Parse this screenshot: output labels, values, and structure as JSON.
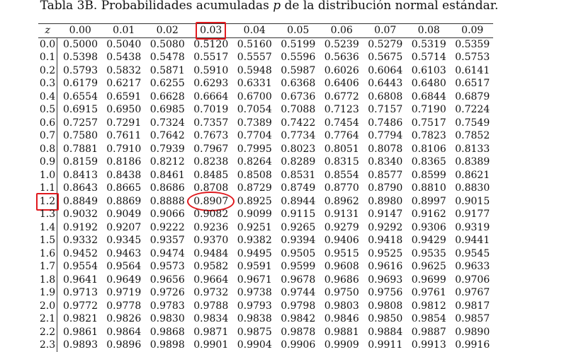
{
  "title": {
    "before": "Tabla 3B. Probabilidades acumuladas ",
    "var": "p",
    "after": " de la distribución normal estándar."
  },
  "highlight_color": "#e0191e",
  "highlight": {
    "row": "1.2",
    "column": "0.03",
    "value": "0.8907"
  },
  "table": {
    "z_header": "z",
    "columns": [
      "0.00",
      "0.01",
      "0.02",
      "0.03",
      "0.04",
      "0.05",
      "0.06",
      "0.07",
      "0.08",
      "0.09"
    ],
    "rows": [
      {
        "z": "0.0",
        "values": [
          "0.5000",
          "0.5040",
          "0.5080",
          "0.5120",
          "0.5160",
          "0.5199",
          "0.5239",
          "0.5279",
          "0.5319",
          "0.5359"
        ]
      },
      {
        "z": "0.1",
        "values": [
          "0.5398",
          "0.5438",
          "0.5478",
          "0.5517",
          "0.5557",
          "0.5596",
          "0.5636",
          "0.5675",
          "0.5714",
          "0.5753"
        ]
      },
      {
        "z": "0.2",
        "values": [
          "0.5793",
          "0.5832",
          "0.5871",
          "0.5910",
          "0.5948",
          "0.5987",
          "0.6026",
          "0.6064",
          "0.6103",
          "0.6141"
        ]
      },
      {
        "z": "0.3",
        "values": [
          "0.6179",
          "0.6217",
          "0.6255",
          "0.6293",
          "0.6331",
          "0.6368",
          "0.6406",
          "0.6443",
          "0.6480",
          "0.6517"
        ]
      },
      {
        "z": "0.4",
        "values": [
          "0.6554",
          "0.6591",
          "0.6628",
          "0.6664",
          "0.6700",
          "0.6736",
          "0.6772",
          "0.6808",
          "0.6844",
          "0.6879"
        ]
      },
      {
        "z": "0.5",
        "values": [
          "0.6915",
          "0.6950",
          "0.6985",
          "0.7019",
          "0.7054",
          "0.7088",
          "0.7123",
          "0.7157",
          "0.7190",
          "0.7224"
        ]
      },
      {
        "z": "0.6",
        "values": [
          "0.7257",
          "0.7291",
          "0.7324",
          "0.7357",
          "0.7389",
          "0.7422",
          "0.7454",
          "0.7486",
          "0.7517",
          "0.7549"
        ]
      },
      {
        "z": "0.7",
        "values": [
          "0.7580",
          "0.7611",
          "0.7642",
          "0.7673",
          "0.7704",
          "0.7734",
          "0.7764",
          "0.7794",
          "0.7823",
          "0.7852"
        ]
      },
      {
        "z": "0.8",
        "values": [
          "0.7881",
          "0.7910",
          "0.7939",
          "0.7967",
          "0.7995",
          "0.8023",
          "0.8051",
          "0.8078",
          "0.8106",
          "0.8133"
        ]
      },
      {
        "z": "0.9",
        "values": [
          "0.8159",
          "0.8186",
          "0.8212",
          "0.8238",
          "0.8264",
          "0.8289",
          "0.8315",
          "0.8340",
          "0.8365",
          "0.8389"
        ]
      },
      {
        "z": "1.0",
        "values": [
          "0.8413",
          "0.8438",
          "0.8461",
          "0.8485",
          "0.8508",
          "0.8531",
          "0.8554",
          "0.8577",
          "0.8599",
          "0.8621"
        ]
      },
      {
        "z": "1.1",
        "values": [
          "0.8643",
          "0.8665",
          "0.8686",
          "0.8708",
          "0.8729",
          "0.8749",
          "0.8770",
          "0.8790",
          "0.8810",
          "0.8830"
        ]
      },
      {
        "z": "1.2",
        "values": [
          "0.8849",
          "0.8869",
          "0.8888",
          "0.8907",
          "0.8925",
          "0.8944",
          "0.8962",
          "0.8980",
          "0.8997",
          "0.9015"
        ]
      },
      {
        "z": "1.3",
        "values": [
          "0.9032",
          "0.9049",
          "0.9066",
          "0.9082",
          "0.9099",
          "0.9115",
          "0.9131",
          "0.9147",
          "0.9162",
          "0.9177"
        ]
      },
      {
        "z": "1.4",
        "values": [
          "0.9192",
          "0.9207",
          "0.9222",
          "0.9236",
          "0.9251",
          "0.9265",
          "0.9279",
          "0.9292",
          "0.9306",
          "0.9319"
        ]
      },
      {
        "z": "1.5",
        "values": [
          "0.9332",
          "0.9345",
          "0.9357",
          "0.9370",
          "0.9382",
          "0.9394",
          "0.9406",
          "0.9418",
          "0.9429",
          "0.9441"
        ]
      },
      {
        "z": "1.6",
        "values": [
          "0.9452",
          "0.9463",
          "0.9474",
          "0.9484",
          "0.9495",
          "0.9505",
          "0.9515",
          "0.9525",
          "0.9535",
          "0.9545"
        ]
      },
      {
        "z": "1.7",
        "values": [
          "0.9554",
          "0.9564",
          "0.9573",
          "0.9582",
          "0.9591",
          "0.9599",
          "0.9608",
          "0.9616",
          "0.9625",
          "0.9633"
        ]
      },
      {
        "z": "1.8",
        "values": [
          "0.9641",
          "0.9649",
          "0.9656",
          "0.9664",
          "0.9671",
          "0.9678",
          "0.9686",
          "0.9693",
          "0.9699",
          "0.9706"
        ]
      },
      {
        "z": "1.9",
        "values": [
          "0.9713",
          "0.9719",
          "0.9726",
          "0.9732",
          "0.9738",
          "0.9744",
          "0.9750",
          "0.9756",
          "0.9761",
          "0.9767"
        ]
      },
      {
        "z": "2.0",
        "values": [
          "0.9772",
          "0.9778",
          "0.9783",
          "0.9788",
          "0.9793",
          "0.9798",
          "0.9803",
          "0.9808",
          "0.9812",
          "0.9817"
        ]
      },
      {
        "z": "2.1",
        "values": [
          "0.9821",
          "0.9826",
          "0.9830",
          "0.9834",
          "0.9838",
          "0.9842",
          "0.9846",
          "0.9850",
          "0.9854",
          "0.9857"
        ]
      },
      {
        "z": "2.2",
        "values": [
          "0.9861",
          "0.9864",
          "0.9868",
          "0.9871",
          "0.9875",
          "0.9878",
          "0.9881",
          "0.9884",
          "0.9887",
          "0.9890"
        ]
      },
      {
        "z": "2.3",
        "values": [
          "0.9893",
          "0.9896",
          "0.9898",
          "0.9901",
          "0.9904",
          "0.9906",
          "0.9909",
          "0.9911",
          "0.9913",
          "0.9916"
        ]
      }
    ]
  }
}
